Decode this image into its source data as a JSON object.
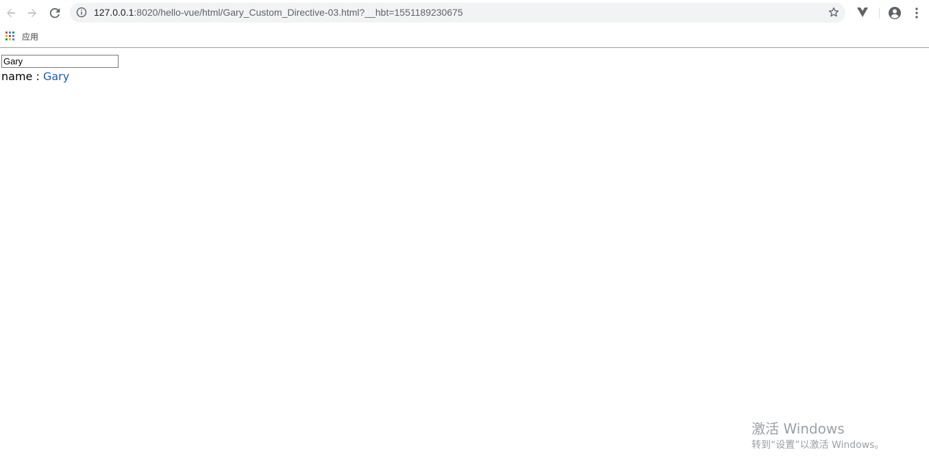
{
  "browser": {
    "url_host": "127.0.0.1",
    "url_rest": ":8020/hello-vue/html/Gary_Custom_Directive-03.html?__hbt=1551189230675",
    "icons": {
      "back": "arrow-left-icon",
      "forward": "arrow-right-icon",
      "reload": "reload-icon",
      "info": "info-icon",
      "star": "star-icon",
      "extension": "vue-devtools-icon",
      "profile": "profile-icon",
      "menu": "kebab-menu-icon"
    }
  },
  "bookmarks": {
    "apps_label": "应用"
  },
  "page": {
    "input_value": "Gary",
    "name_label": "name : ",
    "name_value": "Gary"
  },
  "watermark": {
    "title": "激活 Windows",
    "subtitle": "转到“设置”以激活 Windows。"
  },
  "colors": {
    "name_value": "#1a56c6",
    "omnibox_bg": "#f1f3f4",
    "icon": "#5f6368"
  }
}
